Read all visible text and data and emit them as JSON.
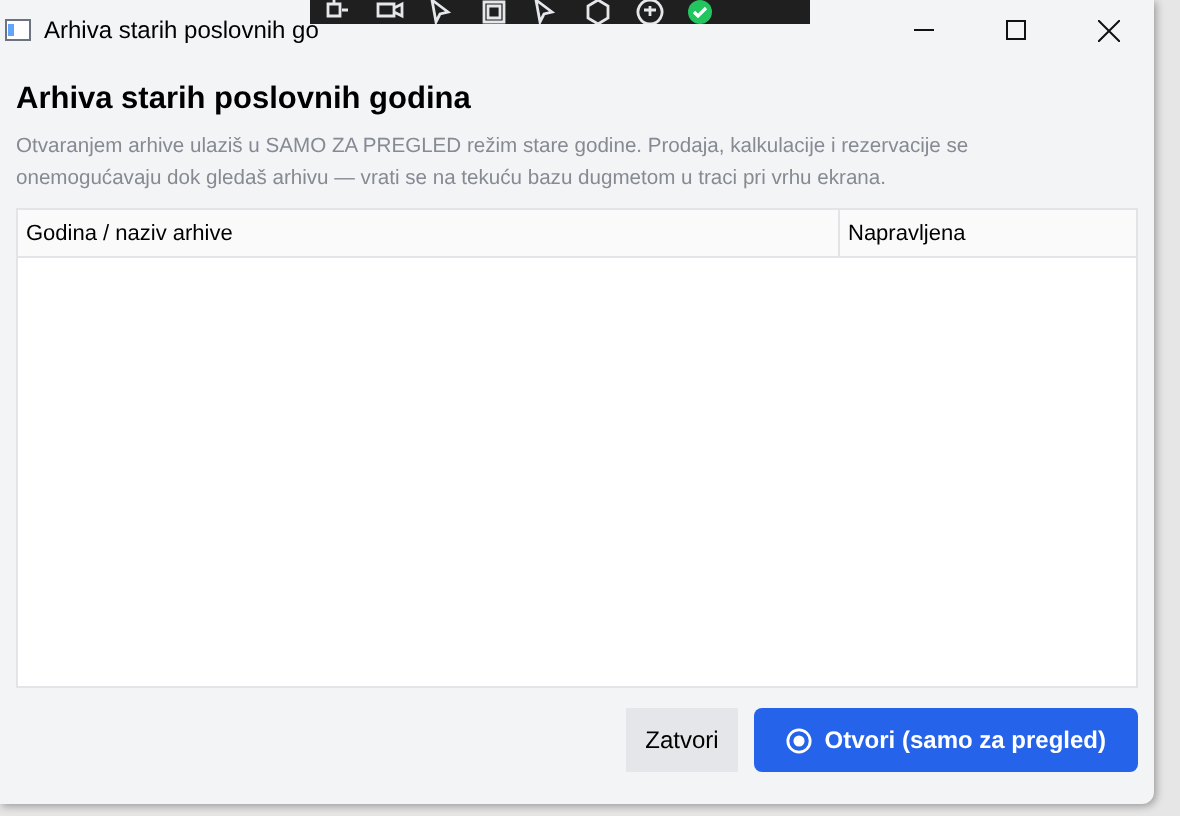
{
  "window": {
    "title": "Arhiva starih poslovnih go"
  },
  "dialog": {
    "heading": "Arhiva starih poslovnih godina",
    "description": "Otvaranjem arhive ulaziš u SAMO ZA PREGLED režim stare godine. Prodaja, kalkulacije i rezervacije se onemogućavaju dok gledaš arhivu — vrati se na tekuću bazu dugmetom u traci pri vrhu ekrana."
  },
  "table": {
    "columns": [
      "Godina / naziv arhive",
      "Napravljena"
    ]
  },
  "buttons": [
    {
      "label": "Zatvori",
      "kind": "secondary"
    },
    {
      "label": "Otvori (samo za pregled)",
      "kind": "primary"
    }
  ]
}
